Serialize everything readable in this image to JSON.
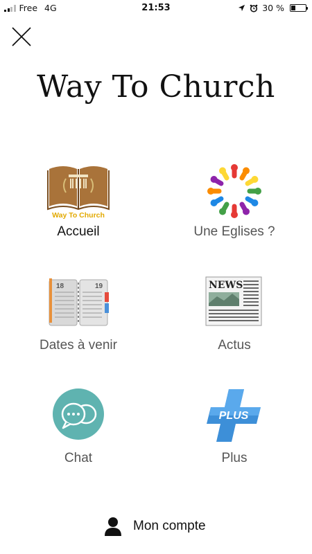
{
  "status_bar": {
    "carrier": "Free",
    "network": "4G",
    "time": "21:53",
    "battery_text": "30 %",
    "battery_level": 0.3
  },
  "header": {
    "title": "Way To Church",
    "close_icon": "close-icon"
  },
  "menu": {
    "items": [
      {
        "label": "Accueil",
        "icon": "bible-logo-icon",
        "logo_text": "Way To Church",
        "active": true
      },
      {
        "label": "Une Eglises ?",
        "icon": "community-circle-icon",
        "active": false
      },
      {
        "label": "Dates à venir",
        "icon": "agenda-icon",
        "page_left": "18",
        "page_right": "19",
        "active": false
      },
      {
        "label": "Actus",
        "icon": "newspaper-icon",
        "logo_text": "NEWS",
        "active": false
      },
      {
        "label": "Chat",
        "icon": "chat-bubbles-icon",
        "active": false
      },
      {
        "label": "Plus",
        "icon": "plus-icon",
        "logo_text": "PLUS",
        "active": false
      }
    ]
  },
  "footer": {
    "account_label": "Mon compte",
    "account_icon": "user-icon"
  },
  "colors": {
    "title": "#111111",
    "label": "#555555",
    "chat_bg": "#5fb3b0",
    "plus_blue": "#3d8fd8",
    "logo_gold": "#e2a900",
    "book_brown": "#a9733a"
  }
}
